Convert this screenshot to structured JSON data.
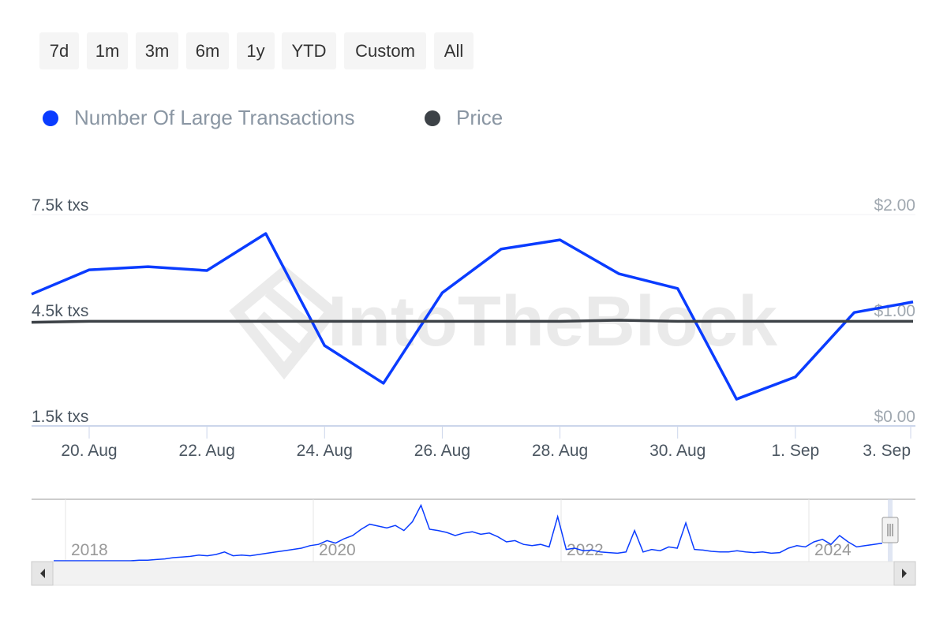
{
  "range_buttons": [
    "7d",
    "1m",
    "3m",
    "6m",
    "1y",
    "YTD",
    "Custom",
    "All"
  ],
  "legend": [
    {
      "label": "Number Of Large Transactions",
      "color": "#0a3cff"
    },
    {
      "label": "Price",
      "color": "#3d4247"
    }
  ],
  "watermark": "IntoTheBlock",
  "chart_data": {
    "type": "line",
    "x": [
      "19 Aug",
      "20 Aug",
      "21 Aug",
      "22 Aug",
      "23 Aug",
      "24 Aug",
      "25 Aug",
      "26 Aug",
      "27 Aug",
      "28 Aug",
      "29 Aug",
      "30 Aug",
      "31 Aug",
      "1 Sep",
      "2 Sep",
      "3 Sep"
    ],
    "series": [
      {
        "name": "Number Of Large Transactions",
        "axis": "left",
        "color": "#0a3cff",
        "values": [
          5240,
          5930,
          6020,
          5910,
          6960,
          3780,
          2710,
          5280,
          6520,
          6780,
          5820,
          5400,
          2260,
          2890,
          4720,
          5020
        ]
      },
      {
        "name": "Price",
        "axis": "right",
        "color": "#3d4247",
        "values": [
          0.98,
          0.99,
          0.99,
          0.99,
          0.99,
          0.99,
          0.99,
          0.99,
          0.99,
          0.99,
          1.0,
          0.99,
          0.99,
          0.99,
          0.99,
          0.99
        ]
      }
    ],
    "left_axis": {
      "ticks": [
        "7.5k txs",
        "4.5k txs",
        "1.5k txs"
      ],
      "range": [
        1500,
        7500
      ]
    },
    "right_axis": {
      "ticks": [
        "$2.00",
        "$1.00",
        "$0.00"
      ],
      "range": [
        0,
        2
      ]
    },
    "x_ticks": [
      "20. Aug",
      "22. Aug",
      "24. Aug",
      "26. Aug",
      "28. Aug",
      "30. Aug",
      "1. Sep",
      "3. Sep"
    ],
    "navigator": {
      "x_ticks": [
        "2018",
        "2020",
        "2022",
        "2024"
      ],
      "values": [
        0,
        0,
        0,
        0,
        0,
        0,
        0,
        0,
        0,
        0,
        1,
        1,
        2,
        3,
        5,
        6,
        7,
        9,
        8,
        10,
        14,
        8,
        9,
        8,
        10,
        12,
        14,
        16,
        18,
        20,
        24,
        26,
        32,
        28,
        35,
        40,
        50,
        58,
        55,
        52,
        56,
        48,
        62,
        88,
        50,
        48,
        45,
        40,
        44,
        46,
        42,
        44,
        38,
        30,
        32,
        26,
        24,
        26,
        22,
        70,
        18,
        20,
        16,
        17,
        14,
        13,
        12,
        14,
        48,
        14,
        18,
        16,
        22,
        20,
        60,
        18,
        17,
        15,
        14,
        14,
        16,
        14,
        13,
        14,
        12,
        13,
        20,
        24,
        22,
        30,
        34,
        26,
        40,
        30,
        22,
        24,
        26,
        28
      ]
    }
  }
}
